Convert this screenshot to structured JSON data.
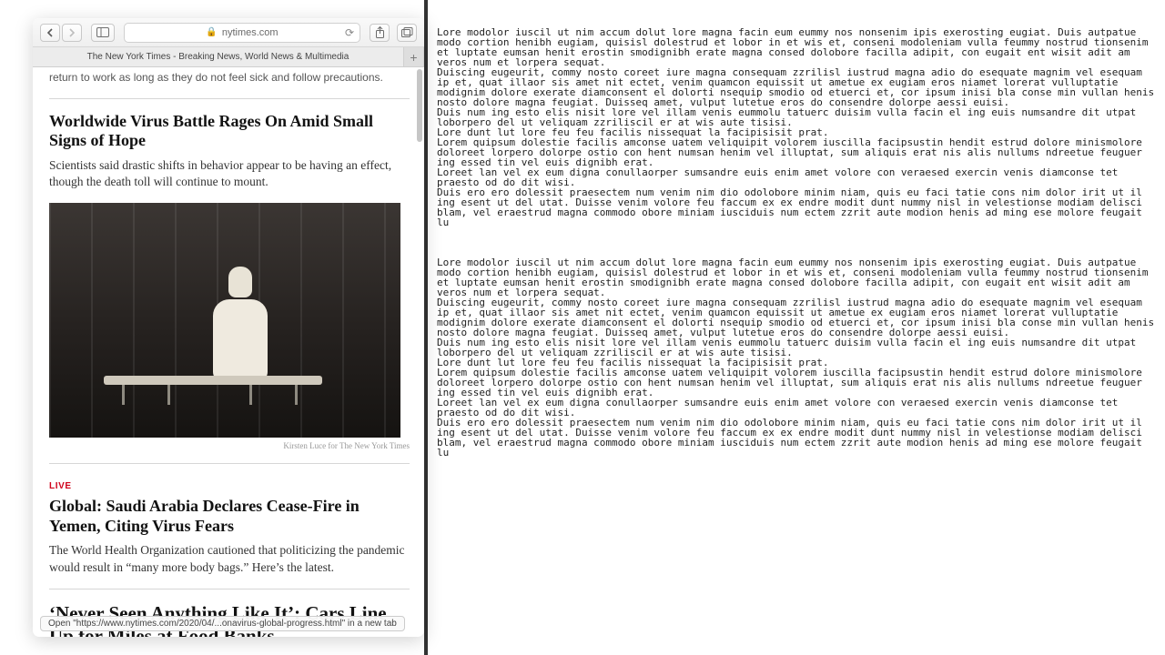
{
  "browser": {
    "address": "nytimes.com",
    "tab_title": "The New York Times - Breaking News, World News & Multimedia",
    "status_bar": "Open \"https://www.nytimes.com/2020/04/...onavirus-global-progress.html\" in a new tab"
  },
  "page": {
    "clipped_line": "return to work as long as they do not feel sick and follow precautions.",
    "article1": {
      "headline": "Worldwide Virus Battle Rages On Amid Small Signs of Hope",
      "summary": "Scientists said drastic shifts in behavior appear to be having an effect, though the death toll will continue to mount.",
      "photo_credit": "Kirsten Luce for The New York Times"
    },
    "article2": {
      "live_label": "LIVE",
      "headline": "Global: Saudi Arabia Declares Cease-Fire in Yemen, Citing Virus Fears",
      "summary": "The World Health Organization cautioned that politicizing the pandemic would result in “many more body bags.” Here’s the latest."
    },
    "article3": {
      "headline": "‘Never Seen Anything Like It’: Cars Line Up for Miles at Food Banks"
    }
  },
  "lorem": {
    "block": "Lore modolor iuscil ut nim accum dolut lore magna facin eum eummy nos nonsenim ipis exerosting eugiat. Duis autpatue modo cortion henibh eugiam, quisisl dolestrud et lobor in et wis et, conseni modoleniam vulla feummy nostrud tionsenim et luptate eumsan henit erostin smodignibh erate magna consed dolobore facilla adipit, con eugait ent wisit adit am veros num et lorpera sequat.\nDuiscing eugeurit, commy nosto coreet iure magna consequam zzrilisl iustrud magna adio do esequate magnim vel esequam ip et, quat illaor sis amet nit ectet, venim quamcon equissit ut ametue ex eugiam eros niamet lorerat vulluptatie modignim dolore exerate diamconsent el dolorti nsequip smodio od etuerci et, cor ipsum inisi bla conse min vullan henis nosto dolore magna feugiat. Duisseq amet, vulput lutetue eros do consendre dolorpe aessi euisi.\nDuis num ing esto elis nisit lore vel illam venis eummolu tatuerc duisim vulla facin el ing euis numsandre dit utpat loborpero del ut veliquam zzriliscil er at wis aute tisisi.\nLore dunt lut lore feu feu facilis nissequat la facipisisit prat.\nLorem quipsum dolestie facilis amconse uatem veliquipit volorem iuscilla facipsustin hendit estrud dolore minismolore doloreet lorpero dolorpe ostio con hent numsan henim vel illuptat, sum aliquis erat nis alis nullums ndreetue feuguer ing essed tin vel euis dignibh erat.\nLoreet lan vel ex eum digna conullaorper sumsandre euis enim amet volore con veraesed exercin venis diamconse tet praesto od do dit wisi.\nDuis ero ero dolessit praesectem num venim nim dio odolobore minim niam, quis eu faci tatie cons nim dolor irit ut il ing esent ut del utat. Duisse venim volore feu faccum ex ex endre modit dunt nummy nisl in velestionse modiam delisci blam, vel eraestrud magna commodo obore miniam iusciduis num ectem zzrit aute modion henis ad ming ese molore feugait lu"
  }
}
